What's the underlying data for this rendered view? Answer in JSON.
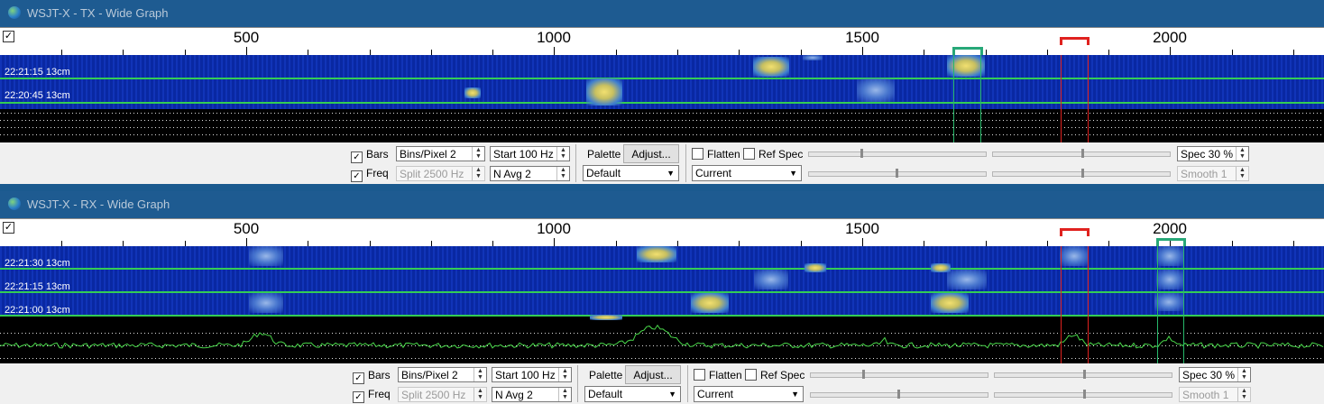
{
  "tx": {
    "title": "WSJT-X - TX - Wide Graph",
    "timestamps": [
      "22:21:15   13cm",
      "22:20:45   13cm"
    ]
  },
  "rx": {
    "title": "WSJT-X - RX - Wide Graph",
    "timestamps": [
      "22:21:30   13cm",
      "22:21:15   13cm",
      "22:21:00   13cm"
    ]
  },
  "scale": {
    "labels": [
      "500",
      "1000",
      "1500",
      "2000"
    ]
  },
  "controls": {
    "bars_label": "Bars",
    "freq_label": "Freq",
    "bins_pixel": "Bins/Pixel  2",
    "start": "Start 100 Hz",
    "split": "Split  2500  Hz",
    "navg": "N Avg 2",
    "palette_label": "Palette",
    "adjust_label": "Adjust...",
    "palette_value": "Default",
    "flatten_label": "Flatten",
    "refspec_label": "Ref Spec",
    "spectrum_value": "Current",
    "spec": "Spec 30 %",
    "smooth": "Smooth  1"
  },
  "check_mark": "✓",
  "colors": {
    "sep_green": "#33cc55",
    "rx_green": "#27b86a",
    "tx_red": "#e0221f"
  }
}
